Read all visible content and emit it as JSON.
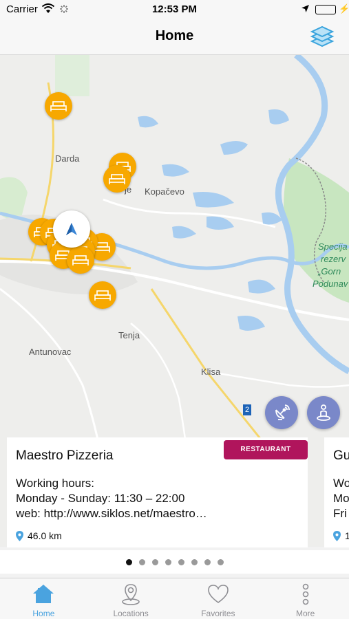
{
  "status_bar": {
    "carrier": "Carrier",
    "time": "12:53 PM",
    "wifi_icon": "wifi-icon",
    "location_icon": "location-arrow-icon",
    "battery_level": 1.0
  },
  "nav": {
    "title": "Home",
    "layers_icon": "layers-icon"
  },
  "map": {
    "labels": {
      "darda": "Darda",
      "kopacevo": "Kopačevo",
      "bilje_fragment": "je",
      "tenja": "Tenja",
      "antunovac": "Antunovac",
      "klisa": "Klisa",
      "park_line1": "Specija",
      "park_line2": "rezerv",
      "park_line3": "„Gorn",
      "park_line4": "Podunav"
    },
    "road_sign": "2",
    "pin_icon": "bed-icon",
    "pin_color": "#f7a800",
    "user_location_icon": "navigation-arrow-icon",
    "fab_nearby_icon": "signal-dish-icon",
    "fab_person_icon": "person-pin-icon"
  },
  "cards": [
    {
      "name": "Maestro Pizzeria",
      "badge": "RESTAURANT",
      "hours_label": "Working hours:",
      "hours": "Monday - Sunday: 11:30 – 22:00",
      "web": "web: http://www.siklos.net/maestro…",
      "distance": "46.0 km"
    },
    {
      "name": "Gu",
      "line1": "Wo",
      "line2": "Mo",
      "line3": "Fri",
      "distance": "1"
    }
  ],
  "pagination": {
    "count": 8,
    "active": 0
  },
  "tabs": [
    {
      "label": "Home",
      "icon": "home-icon",
      "active": true
    },
    {
      "label": "Locations",
      "icon": "map-pin-icon",
      "active": false
    },
    {
      "label": "Favorites",
      "icon": "heart-icon",
      "active": false
    },
    {
      "label": "More",
      "icon": "more-dots-icon",
      "active": false
    }
  ],
  "colors": {
    "accent": "#4aa3df",
    "badge": "#b0155c",
    "fab": "#7a88c9",
    "water": "#a8cdf0",
    "park": "#c8e6c0"
  }
}
